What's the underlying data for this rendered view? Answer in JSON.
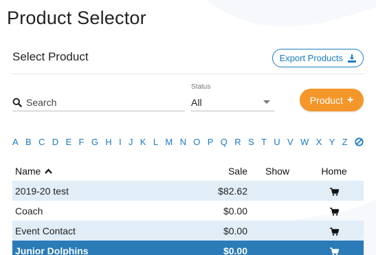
{
  "page": {
    "title": "Product Selector"
  },
  "card": {
    "title": "Select Product",
    "export_label": "Export Products"
  },
  "filters": {
    "search_placeholder": "Search",
    "search_value": "",
    "status_label": "Status",
    "status_value": "All",
    "add_product_label": "Product"
  },
  "alphabet": [
    "A",
    "B",
    "C",
    "D",
    "E",
    "F",
    "G",
    "H",
    "I",
    "J",
    "K",
    "L",
    "M",
    "N",
    "O",
    "P",
    "Q",
    "R",
    "S",
    "T",
    "U",
    "V",
    "W",
    "X",
    "Y",
    "Z"
  ],
  "table": {
    "headers": {
      "name": "Name",
      "sale": "Sale",
      "show": "Show",
      "home": "Home"
    },
    "rows": [
      {
        "name": "2019-20 test",
        "sale": "$82.62",
        "show": "",
        "home_icon": "cart-icon"
      },
      {
        "name": "Coach",
        "sale": "$0.00",
        "show": "",
        "home_icon": "cart-icon"
      },
      {
        "name": "Event Contact",
        "sale": "$0.00",
        "show": "",
        "home_icon": "cart-icon"
      },
      {
        "name": "Junior Dolphins",
        "sale": "$0.00",
        "show": "",
        "home_icon": "cart-icon"
      }
    ]
  },
  "colors": {
    "accent_blue": "#1a7bbf",
    "accent_orange": "#f5962a",
    "row_alt": "#e1edf7",
    "row_selected": "#2a7bb8"
  }
}
